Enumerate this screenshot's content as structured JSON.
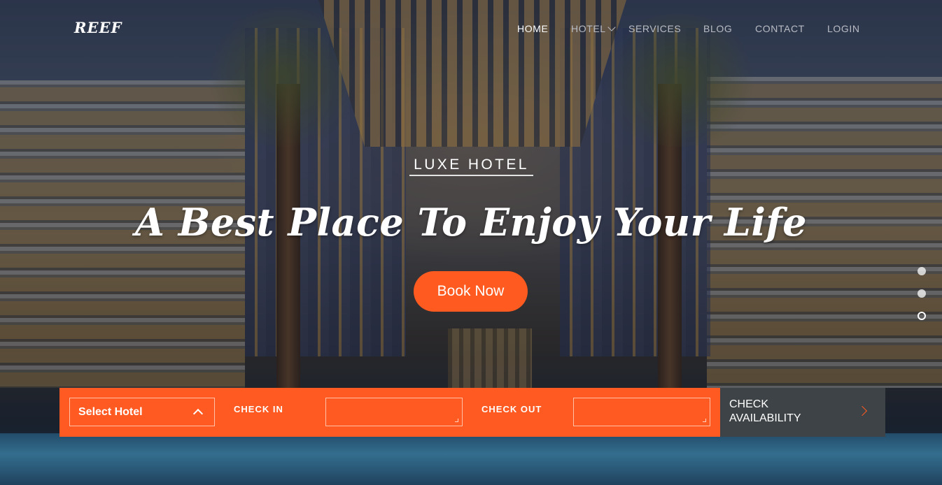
{
  "brand": {
    "logo_text": "REEF"
  },
  "nav": {
    "items": [
      {
        "label": "HOME",
        "active": true
      },
      {
        "label": "HOTEL",
        "has_dropdown": true,
        "icon": "chevron-down-icon"
      },
      {
        "label": "SERVICES"
      },
      {
        "label": "BLOG"
      },
      {
        "label": "CONTACT"
      },
      {
        "label": "LOGIN"
      }
    ]
  },
  "hero": {
    "eyebrow": "LUXE HOTEL",
    "headline": "A Best Place To Enjoy Your Life",
    "cta_label": "Book Now",
    "slides": {
      "count": 3,
      "active_index": 3
    }
  },
  "booking": {
    "select_hotel": {
      "value": "Select Hotel",
      "icon": "chevron-up-icon"
    },
    "check_in_label": "CHECK IN",
    "check_in_value": "",
    "check_out_label": "CHECK OUT",
    "check_out_value": "",
    "submit": {
      "line1": "CHECK",
      "line2": "AVAILABILITY",
      "icon": "chevron-right-icon"
    }
  },
  "colors": {
    "accent": "#ff5a22",
    "dark_button": "#3d4346",
    "nav_text": "#b9bcc4",
    "nav_active": "#ffffff"
  }
}
